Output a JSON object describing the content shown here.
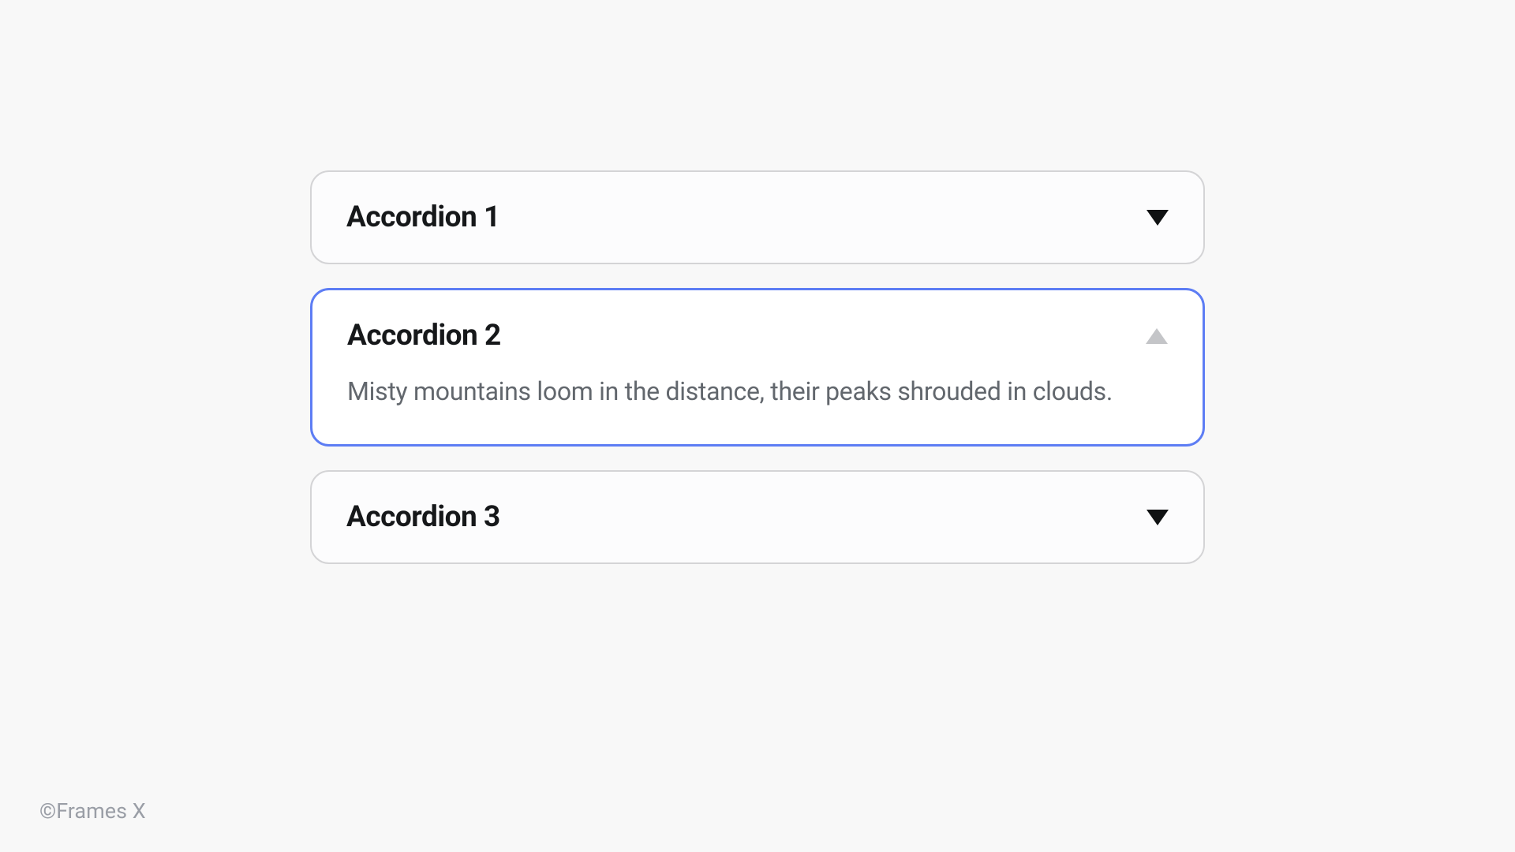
{
  "accordions": [
    {
      "title": "Accordion 1",
      "expanded": false
    },
    {
      "title": "Accordion 2",
      "expanded": true,
      "content": "Misty mountains loom in the distance, their peaks shrouded in clouds."
    },
    {
      "title": "Accordion 3",
      "expanded": false
    }
  ],
  "copyright": "©Frames X"
}
